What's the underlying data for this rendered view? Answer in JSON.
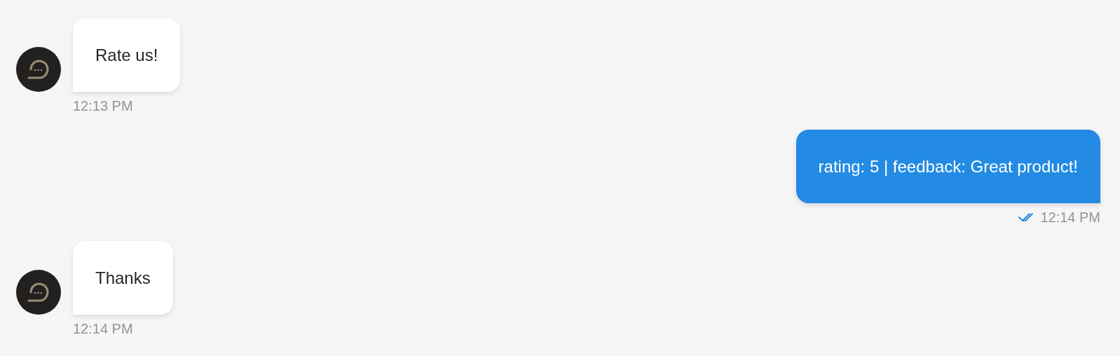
{
  "messages": [
    {
      "kind": "incoming",
      "text": "Rate us!",
      "time": "12:13 PM"
    },
    {
      "kind": "outgoing",
      "text": "rating: 5 | feedback: Great product!",
      "time": "12:14 PM",
      "read": true
    },
    {
      "kind": "incoming",
      "text": "Thanks",
      "time": "12:14 PM"
    }
  ]
}
